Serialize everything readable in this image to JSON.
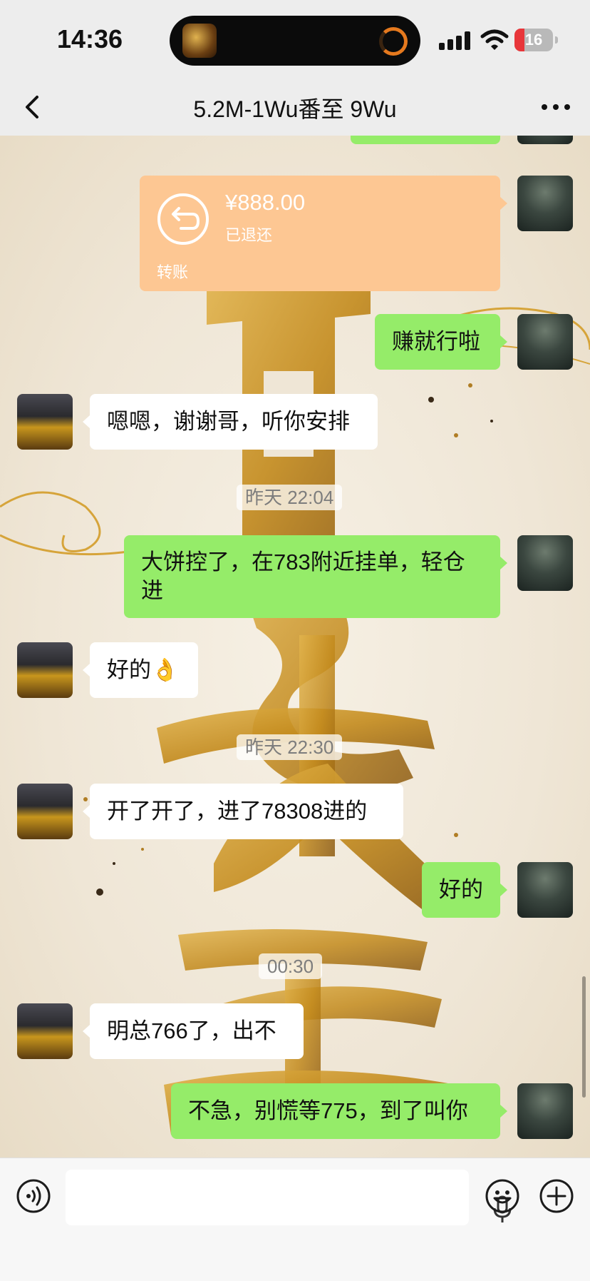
{
  "status_bar": {
    "time": "14:36",
    "battery": "16"
  },
  "nav": {
    "title": "5.2M-1Wu番至 9Wu"
  },
  "transfer": {
    "amount": "¥888.00",
    "status": "已退还",
    "label": "转账"
  },
  "messages": [
    {
      "text": "赚就行啦"
    },
    {
      "text": "嗯嗯，谢谢哥，听你安排"
    },
    {
      "text": "大饼控了，在783附近挂单，轻仓进"
    },
    {
      "text": "好的👌"
    },
    {
      "text": "开了开了，进了78308进的"
    },
    {
      "text": "好的"
    },
    {
      "text": "明总766了，出不"
    },
    {
      "text": "不急，别慌等775，到了叫你"
    }
  ],
  "timestamps": [
    "昨天 22:04",
    "昨天 22:30",
    "00:30"
  ],
  "colors": {
    "me_bubble": "#95ec69",
    "other_bubble": "#ffffff",
    "transfer": "#fdc793",
    "accent_gold": "#c8961d"
  }
}
